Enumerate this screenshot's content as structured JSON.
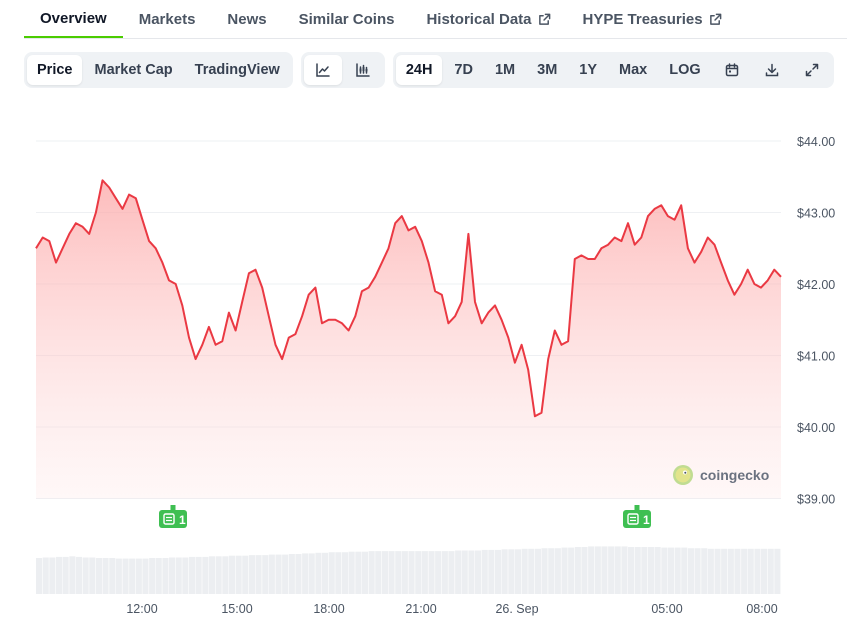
{
  "nav": {
    "tabs": [
      {
        "label": "Overview",
        "active": true
      },
      {
        "label": "Markets"
      },
      {
        "label": "News"
      },
      {
        "label": "Similar Coins"
      },
      {
        "label": "Historical Data",
        "external": true
      },
      {
        "label": "HYPE Treasuries",
        "external": true
      }
    ]
  },
  "toolbar": {
    "view_tabs": [
      "Price",
      "Market Cap",
      "TradingView"
    ],
    "active_view": "Price",
    "chart_type_icons": [
      "line-chart-icon",
      "candlestick-chart-icon"
    ],
    "ranges": [
      "24H",
      "7D",
      "1M",
      "3M",
      "1Y",
      "Max",
      "LOG"
    ],
    "active_range": "24H",
    "action_icons": [
      "calendar-icon",
      "download-icon",
      "fullscreen-icon"
    ]
  },
  "watermark": {
    "label": "coingecko"
  },
  "colors": {
    "line": "#ea3943",
    "fill_top": "#fecaca",
    "accent": "#4bcc00",
    "event_badge": "#3fbf52",
    "volume": "#eceef1"
  },
  "chart_data": {
    "type": "area",
    "x_tick_labels": [
      "12:00",
      "15:00",
      "18:00",
      "21:00",
      "26. Sep",
      "05:00",
      "08:00"
    ],
    "y_tick_labels": [
      "$44.00",
      "$43.00",
      "$42.00",
      "$41.00",
      "$40.00",
      "$39.00"
    ],
    "y_ticks": [
      44,
      43,
      42,
      41,
      40,
      39
    ],
    "ylim": [
      38.4,
      44.6
    ],
    "grid": true,
    "series": [
      {
        "values": [
          42.5,
          42.65,
          42.6,
          42.3,
          42.5,
          42.7,
          42.85,
          42.8,
          42.7,
          43.0,
          43.45,
          43.35,
          43.2,
          43.05,
          43.25,
          43.2,
          42.9,
          42.6,
          42.5,
          42.3,
          42.05,
          42.0,
          41.7,
          41.25,
          40.95,
          41.15,
          41.4,
          41.15,
          41.2,
          41.6,
          41.35,
          41.75,
          42.15,
          42.2,
          41.95,
          41.55,
          41.15,
          40.95,
          41.25,
          41.3,
          41.55,
          41.85,
          41.95,
          41.45,
          41.5,
          41.5,
          41.45,
          41.35,
          41.55,
          41.9,
          41.95,
          42.1,
          42.3,
          42.5,
          42.85,
          42.95,
          42.75,
          42.8,
          42.6,
          42.3,
          41.9,
          41.85,
          41.45,
          41.55,
          41.75,
          42.7,
          41.75,
          41.45,
          41.6,
          41.7,
          41.5,
          41.25,
          40.9,
          41.15,
          40.8,
          40.15,
          40.2,
          40.95,
          41.35,
          41.15,
          41.2,
          42.35,
          42.4,
          42.35,
          42.35,
          42.5,
          42.55,
          42.65,
          42.6,
          42.85,
          42.55,
          42.65,
          42.95,
          43.05,
          43.1,
          42.95,
          42.9,
          43.1,
          42.5,
          42.3,
          42.45,
          42.65,
          42.55,
          42.3,
          42.05,
          41.85,
          42.0,
          42.2,
          42.0,
          41.95,
          42.05,
          42.2,
          42.1
        ],
        "x_range": [
          "11:05",
          "08:51"
        ]
      }
    ],
    "volume": [
      0.62,
      0.63,
      0.63,
      0.64,
      0.64,
      0.65,
      0.64,
      0.63,
      0.63,
      0.62,
      0.62,
      0.62,
      0.61,
      0.61,
      0.61,
      0.61,
      0.61,
      0.62,
      0.62,
      0.62,
      0.63,
      0.63,
      0.63,
      0.64,
      0.64,
      0.64,
      0.65,
      0.65,
      0.65,
      0.66,
      0.66,
      0.66,
      0.67,
      0.67,
      0.67,
      0.68,
      0.68,
      0.68,
      0.69,
      0.69,
      0.7,
      0.7,
      0.71,
      0.71,
      0.72,
      0.72,
      0.72,
      0.73,
      0.73,
      0.73,
      0.74,
      0.74,
      0.74,
      0.74,
      0.74,
      0.74,
      0.74,
      0.74,
      0.74,
      0.74,
      0.74,
      0.74,
      0.74,
      0.75,
      0.75,
      0.75,
      0.75,
      0.76,
      0.76,
      0.76,
      0.77,
      0.77,
      0.77,
      0.78,
      0.78,
      0.78,
      0.79,
      0.79,
      0.79,
      0.8,
      0.8,
      0.81,
      0.81,
      0.82,
      0.82,
      0.82,
      0.82,
      0.82,
      0.82,
      0.81,
      0.81,
      0.81,
      0.81,
      0.81,
      0.8,
      0.8,
      0.8,
      0.8,
      0.79,
      0.79,
      0.79,
      0.78,
      0.78,
      0.78,
      0.78,
      0.78,
      0.78,
      0.78,
      0.78,
      0.78,
      0.78,
      0.78
    ],
    "event_markers": [
      {
        "label": "1",
        "at_index": 15
      },
      {
        "label": "1",
        "at_index": 87
      }
    ]
  }
}
